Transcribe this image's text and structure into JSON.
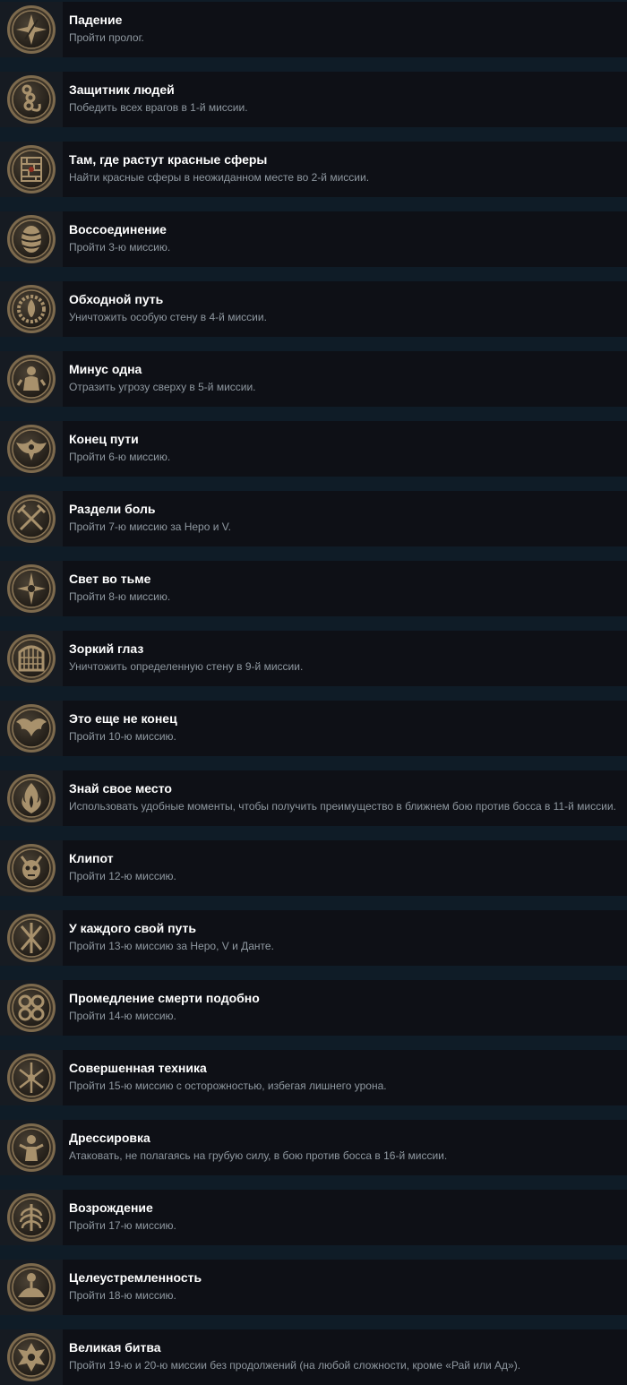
{
  "colors": {
    "page_background": "#0f1c27",
    "row_background": "#0e1016",
    "icon_cell_background": "#161b22",
    "title_text": "#ffffff",
    "description_text": "#8f98a0",
    "medal_bronze": "#a8916c",
    "medal_dark": "#2a251e"
  },
  "achievements": [
    {
      "title": "Падение",
      "description": "Пройти пролог.",
      "icon": "falling-star-medal-icon"
    },
    {
      "title": "Защитник людей",
      "description": "Победить всех врагов в 1-й миссии.",
      "icon": "chain-medal-icon"
    },
    {
      "title": "Там, где растут красные сферы",
      "description": "Найти красные сферы в неожиданном месте во 2-й миссии.",
      "icon": "ruined-wall-medal-icon"
    },
    {
      "title": "Воссоединение",
      "description": "Пройти 3-ю миссию.",
      "icon": "cocoon-medal-icon"
    },
    {
      "title": "Обходной путь",
      "description": "Уничтожить особую стену в 4-й миссии.",
      "icon": "gear-flame-medal-icon"
    },
    {
      "title": "Минус одна",
      "description": "Отразить угрозу сверху в 5-й миссии.",
      "icon": "statue-medal-icon"
    },
    {
      "title": "Конец пути",
      "description": "Пройти 6-ю миссию.",
      "icon": "winged-beast-medal-icon"
    },
    {
      "title": "Раздели боль",
      "description": "Пройти 7-ю миссию за Неро и V.",
      "icon": "crossed-swords-medal-icon"
    },
    {
      "title": "Свет во тьме",
      "description": "Пройти 8-ю миссию.",
      "icon": "light-star-medal-icon"
    },
    {
      "title": "Зоркий глаз",
      "description": "Уничтожить определенную стену в 9-й миссии.",
      "icon": "portcullis-medal-icon"
    },
    {
      "title": "Это еще не конец",
      "description": "Пройти 10-ю миссию.",
      "icon": "bat-wings-medal-icon"
    },
    {
      "title": "Знай свое место",
      "description": "Использовать удобные моменты, чтобы получить преимущество в ближнем бою против босса в 11-й миссии.",
      "icon": "flame-medal-icon"
    },
    {
      "title": "Клипот",
      "description": "Пройти 12-ю миссию.",
      "icon": "demon-skull-medal-icon"
    },
    {
      "title": "У каждого свой путь",
      "description": "Пройти 13-ю миссию за Неро, V и Данте.",
      "icon": "three-blades-medal-icon"
    },
    {
      "title": "Промедление смерти подобно",
      "description": "Пройти 14-ю миссию.",
      "icon": "tentacles-medal-icon"
    },
    {
      "title": "Совершенная техника",
      "description": "Пройти 15-ю миссию с осторожностью, избегая лишнего урона.",
      "icon": "weapons-medal-icon"
    },
    {
      "title": "Дрессировка",
      "description": "Атаковать, не полагаясь на грубую силу, в бою против босса в 16-й миссии.",
      "icon": "tamer-medal-icon"
    },
    {
      "title": "Возрождение",
      "description": "Пройти 17-ю миссию.",
      "icon": "ribcage-medal-icon"
    },
    {
      "title": "Целеустремленность",
      "description": "Пройти 18-ю миссию.",
      "icon": "rider-medal-icon"
    },
    {
      "title": "Великая битва",
      "description": "Пройти 19-ю и 20-ю миссии без продолжений (на любой сложности, кроме «Рай или Ад»).",
      "icon": "great-battle-medal-icon"
    }
  ]
}
